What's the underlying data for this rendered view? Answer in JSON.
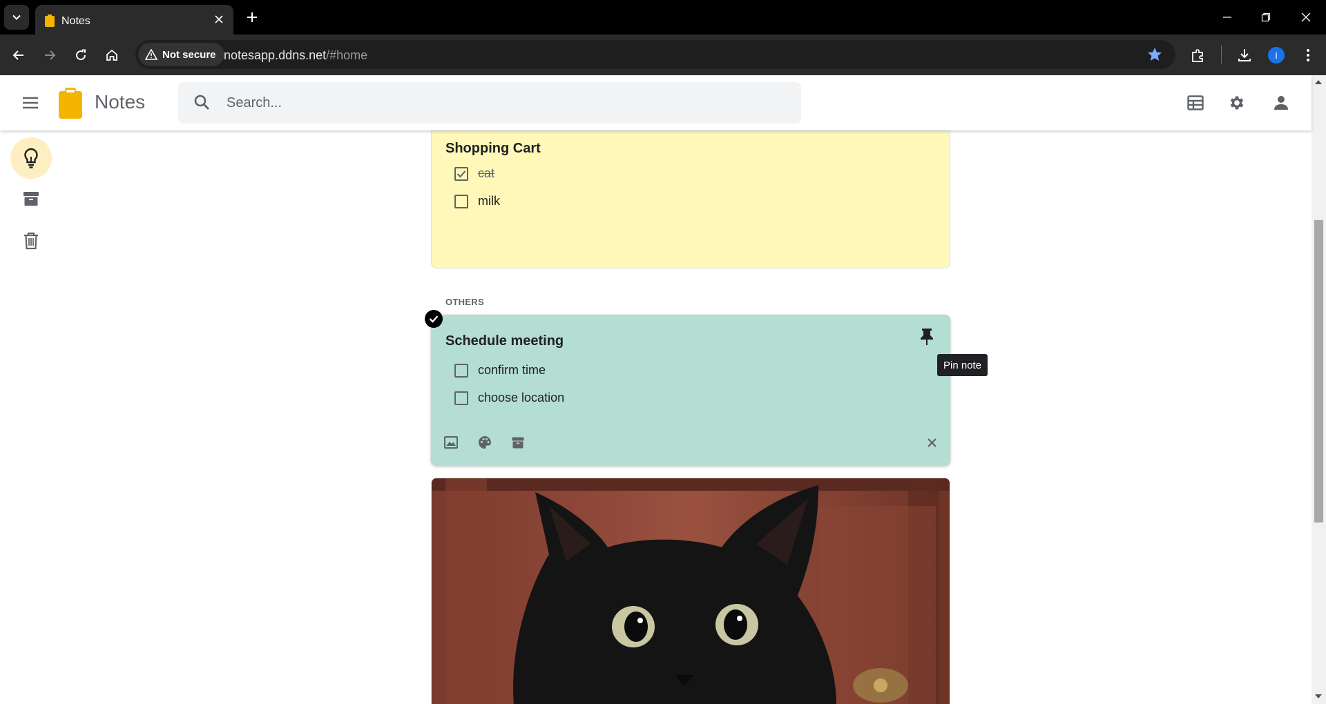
{
  "browser": {
    "tab_title": "Notes",
    "security_label": "Not secure",
    "url_host": "notesapp.ddns.net",
    "url_path": "/#home",
    "profile_initial": "I"
  },
  "app": {
    "title": "Notes",
    "search_placeholder": "Search...",
    "brand_color": "#f4b400"
  },
  "sidebar": {
    "items": [
      {
        "name": "notes",
        "icon": "lightbulb-icon",
        "active": true
      },
      {
        "name": "archive",
        "icon": "archive-icon",
        "active": false
      },
      {
        "name": "trash",
        "icon": "trash-icon",
        "active": false
      }
    ]
  },
  "pinned_note": {
    "title": "Shopping Cart",
    "color": "#fff8b8",
    "items": [
      {
        "text": "cat",
        "checked": true
      },
      {
        "text": "milk",
        "checked": false
      }
    ]
  },
  "others_label": "OTHERS",
  "active_note": {
    "title": "Schedule meeting",
    "color": "#b4ddd3",
    "items": [
      {
        "text": "confirm time",
        "checked": false
      },
      {
        "text": "choose location",
        "checked": false
      }
    ],
    "tooltip": "Pin note"
  },
  "image_note": {
    "image": "black-cat-photo"
  }
}
